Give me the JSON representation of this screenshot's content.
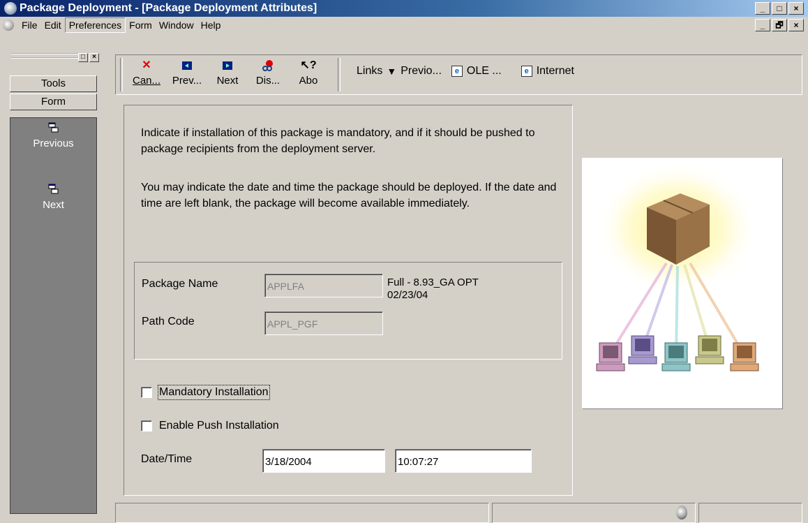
{
  "window": {
    "title": "Package Deployment - [Package Deployment Attributes]",
    "controls": {
      "minimize": "_",
      "maximize": "□",
      "close": "×",
      "restore": "🗗"
    }
  },
  "menu": {
    "items": [
      "File",
      "Edit",
      "Preferences",
      "Form",
      "Window",
      "Help"
    ],
    "active": "Preferences"
  },
  "left_pane": {
    "buttons": [
      "Tools",
      "Form"
    ],
    "exits": [
      {
        "label": "Previous",
        "icon": "previous-exit-icon"
      },
      {
        "label": "Next",
        "icon": "next-exit-icon"
      }
    ]
  },
  "toolbar": {
    "buttons": [
      {
        "label": "Can...",
        "icon": "cancel-x-icon",
        "color": "#e00000"
      },
      {
        "label": "Prev...",
        "icon": "previous-arrow-icon",
        "color": "#002080"
      },
      {
        "label": "Next",
        "icon": "next-arrow-icon",
        "color": "#002080"
      },
      {
        "label": "Dis...",
        "icon": "display-errors-icon",
        "color": "#e00000"
      },
      {
        "label": "Abo",
        "icon": "about-help-icon",
        "color": "#202020"
      }
    ],
    "links_label": "Links",
    "links": [
      "Previo...",
      "OLE ...",
      "Internet"
    ]
  },
  "form": {
    "instruction_1": "Indicate if installation of this package is mandatory, and if it should be pushed to package recipients from the deployment server.",
    "instruction_2": "You may indicate the date and time the package should be deployed. If the date and time are left blank, the package will become available immediately.",
    "package_name_label": "Package Name",
    "package_name_value": "APPLFA",
    "package_description": "Full - 8.93_GA OPT 02/23/04",
    "path_code_label": "Path Code",
    "path_code_value": "APPL_PGF",
    "mandatory_label": "Mandatory Installation",
    "mandatory_checked": false,
    "push_label": "Enable Push Installation",
    "push_checked": false,
    "datetime_label": "Date/Time",
    "date_value": "3/18/2004",
    "time_value": "10:07:27"
  },
  "colors": {
    "title_start": "#0a246a",
    "title_end": "#a6caf0",
    "chrome": "#d4d0c8",
    "exit_bar": "#808080",
    "box": "#8b6a46",
    "glow": "#fff38a",
    "computers": [
      "#cf9ac0",
      "#a89ad0",
      "#8ec6c8",
      "#c8c88a",
      "#e0a878"
    ]
  }
}
